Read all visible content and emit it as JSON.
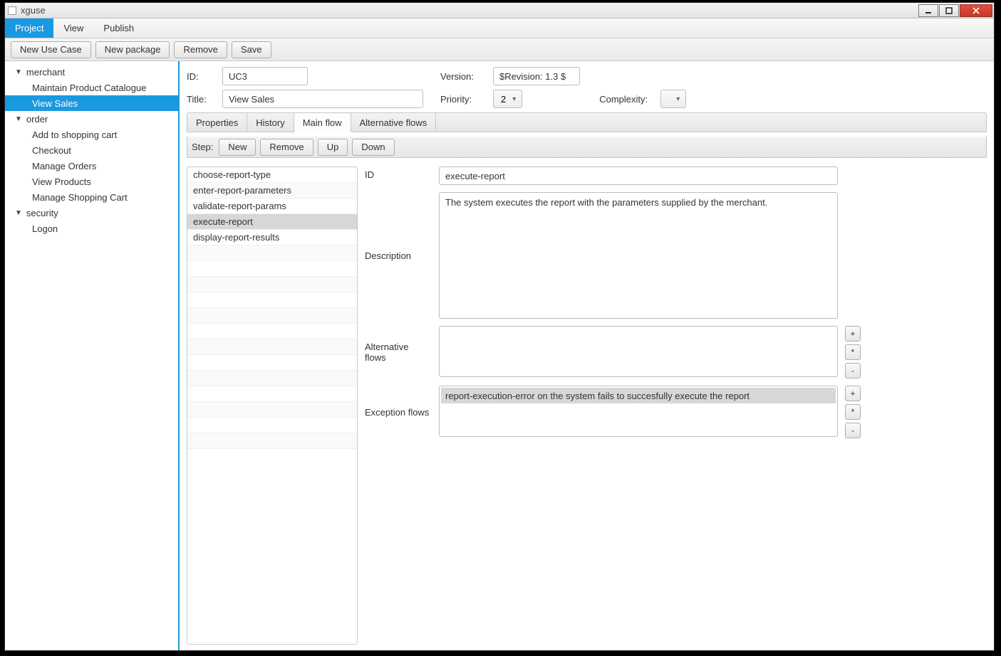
{
  "window": {
    "title": "xguse"
  },
  "menu": {
    "project": "Project",
    "view": "View",
    "publish": "Publish"
  },
  "toolbar": {
    "new_use_case": "New Use Case",
    "new_package": "New package",
    "remove": "Remove",
    "save": "Save"
  },
  "tree": {
    "groups": [
      {
        "name": "merchant",
        "items": [
          "Maintain Product Catalogue",
          "View Sales"
        ],
        "selected": "View Sales"
      },
      {
        "name": "order",
        "items": [
          "Add to shopping cart",
          "Checkout",
          "Manage Orders",
          "View Products",
          "Manage Shopping Cart"
        ]
      },
      {
        "name": "security",
        "items": [
          "Logon"
        ]
      }
    ]
  },
  "form": {
    "id_label": "ID:",
    "id": "UC3",
    "version_label": "Version:",
    "version": "$Revision: 1.3 $",
    "title_label": "Title:",
    "title": "View Sales",
    "priority_label": "Priority:",
    "priority": "2",
    "complexity_label": "Complexity:",
    "complexity": ""
  },
  "tabs": {
    "properties": "Properties",
    "history": "History",
    "main_flow": "Main flow",
    "alt_flows": "Alternative flows"
  },
  "stepbar": {
    "label": "Step:",
    "new": "New",
    "remove": "Remove",
    "up": "Up",
    "down": "Down"
  },
  "steps": [
    "choose-report-type",
    "enter-report-parameters",
    "validate-report-params",
    "execute-report",
    "display-report-results"
  ],
  "selected_step": "execute-report",
  "detail": {
    "id_label": "ID",
    "id": "execute-report",
    "desc_label": "Description",
    "description": "The system executes the report with the parameters supplied by the merchant.",
    "alt_label": "Alternative flows",
    "exc_label": "Exception flows",
    "exception_rows": [
      "report-execution-error on the system fails to succesfully execute the report"
    ],
    "btn_add": "+",
    "btn_star": "*",
    "btn_minus": "-"
  }
}
